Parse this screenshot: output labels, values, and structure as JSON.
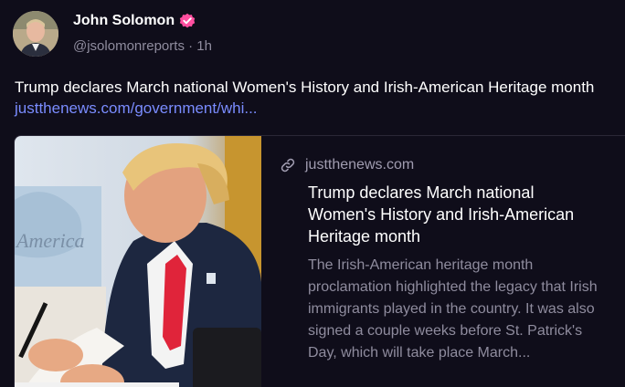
{
  "post": {
    "author_name": "John Solomon",
    "handle": "@jsolomonreports",
    "separator": " · ",
    "timestamp": "1h",
    "text": "Trump declares March national Women's History and Irish-American Heritage month ",
    "link_text": "justthenews.com/government/whi..."
  },
  "card": {
    "domain": "justthenews.com",
    "title": "Trump declares March national Women's History and Irish-American Heritage month",
    "description": "The Irish-American heritage month proclamation highlighted the legacy that Irish immigrants played in the country. It was also signed a couple weeks before St. Patrick's Day, which will take place March...",
    "image_text": "America"
  },
  "colors": {
    "background": "#0f0d1a",
    "verified_badge": "#ff4fa0",
    "link": "#7a8cff",
    "muted_text": "#8f8c9e"
  },
  "icons": {
    "verified": "verified-badge-icon",
    "link": "link-icon"
  }
}
